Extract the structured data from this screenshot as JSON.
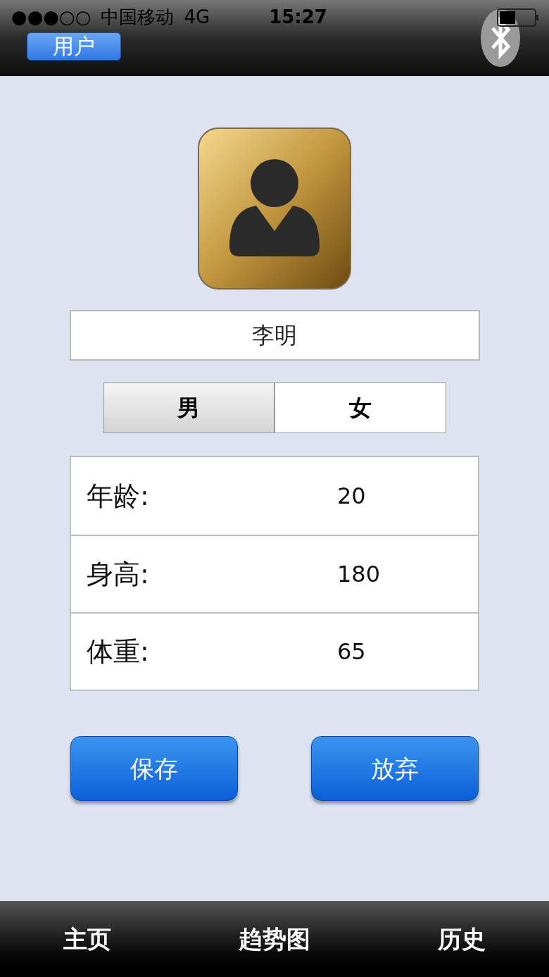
{
  "status_bar": {
    "signal": "●●●○○",
    "carrier": "中国移动",
    "network": "4G",
    "time": "15:27"
  },
  "nav_bar": {
    "user_button": "用户"
  },
  "name_field": {
    "value": "李明"
  },
  "gender": [
    {
      "label": "男",
      "selected": true
    },
    {
      "label": "女",
      "selected": false
    }
  ],
  "fields": [
    {
      "label": "年龄:",
      "value": "20"
    },
    {
      "label": "身高:",
      "value": "180"
    },
    {
      "label": "体重:",
      "value": "65"
    }
  ],
  "buttons": [
    {
      "label": "保存"
    },
    {
      "label": "放弃"
    }
  ],
  "tabs": [
    {
      "label": "主页"
    },
    {
      "label": "趋势图"
    },
    {
      "label": "历史"
    }
  ]
}
